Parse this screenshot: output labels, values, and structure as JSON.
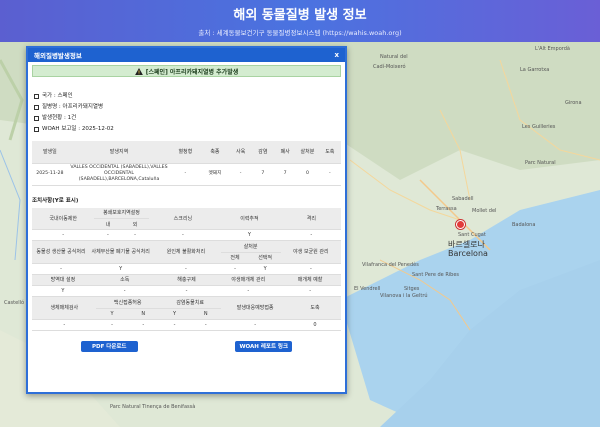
{
  "header": {
    "title": "해외 동물질병 발생 정보",
    "subtitle": "출처 : 세계동물보건기구 동물질병정보시스템 (https://wahis.woah.org)"
  },
  "map": {
    "labels": [
      "L'Alt Empordà",
      "La Garrotxa",
      "Cadí-Moixeró",
      "Les Guilleries",
      "Natural del",
      "Parc Natural",
      "Terrassa",
      "Mollet del",
      "Badalona",
      "Sabadell",
      "Sant Cugat",
      "Vilafranca del Penedès",
      "El Vendrell",
      "Sant Pere de Ribes",
      "Sitges",
      "Vilanova i la Geltrú",
      "Parc Natural Tinença de Benifassà",
      "Castelló",
      "Girona"
    ],
    "city_kr": "바르셀로나",
    "city_en": "Barcelona",
    "marker_color": "#e23b3b"
  },
  "panel": {
    "title": "해외질병발생정보",
    "close": "x",
    "banner": "[스페인] 아프리카돼지열병 추가발생",
    "info": [
      "국가 : 스페인",
      "질병명 : 아프리카돼지열병",
      "발생현황 : 1건",
      "WOAH 보고일 : 2025-12-02"
    ],
    "outbreak": {
      "headers": [
        "발생일",
        "발생지역",
        "혈청형",
        "축종",
        "사육",
        "감염",
        "폐사",
        "살처분",
        "도축"
      ],
      "row": [
        "2025-11-28",
        "VALLES OCCIDENTAL (SABADELL),VALLES OCCIDENTAL (SABADELL),BARCELONA,Cataluña",
        "-",
        "멧돼지",
        "-",
        "7",
        "7",
        "0",
        "-"
      ]
    },
    "measures_title": "조치사항(Y로 표시)",
    "measures1": {
      "h_movement": "국내이동제한",
      "h_zone": "봉쇄보호지역설정",
      "h_zone_in": "내",
      "h_zone_out": "외",
      "h_screening": "스크리닝",
      "h_trace": "이력추적",
      "h_quarantine": "격리",
      "values": [
        "-",
        "-",
        "-",
        "-",
        "Y",
        "-"
      ]
    },
    "measures2": {
      "h_official_dispose": "동물성 생산물 공식처리",
      "h_carcass": "사체부산물 폐기물 공식처리",
      "h_pathogen": "원인체 불활화처리",
      "h_stamping": "살처분",
      "h_stamping_all": "전체",
      "h_stamping_sel": "선택적",
      "h_wildlife": "야생 보균원 관리",
      "values": [
        "-",
        "Y",
        "-",
        "-",
        "Y",
        "-"
      ]
    },
    "measures3": {
      "headers": [
        "방역대 설정",
        "소독",
        "해충구제",
        "야생매개체 관리",
        "매개체 예찰"
      ],
      "values": [
        "Y",
        "-",
        "-",
        "-",
        "-"
      ]
    },
    "measures4": {
      "h_survey": "생체매체검사",
      "h_vaccine_ban": "백신접종허용",
      "h_treat": "감염동물치료",
      "h_yes": "Y",
      "h_no": "N",
      "h_prevent": "발생대응예방접종",
      "h_slaughter": "도축",
      "values": [
        "-",
        "-",
        "-",
        "-",
        "-",
        "-",
        "0"
      ]
    },
    "btn_pdf": "PDF 다운로드",
    "btn_woah": "WOAH 레포트 링크"
  }
}
